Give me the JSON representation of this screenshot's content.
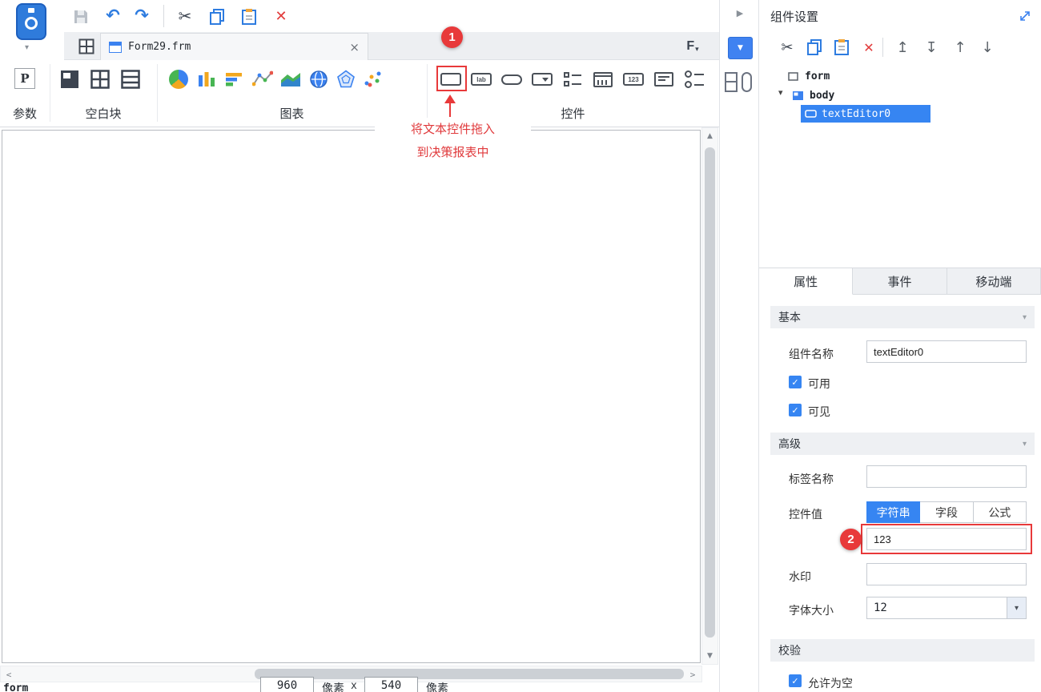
{
  "icons": {
    "undo": "↶",
    "redo": "↷",
    "scissors": "✂",
    "delete_x": "✕",
    "close": "×",
    "caret_down": "▾",
    "dropdown": "▼",
    "collapse": "▶",
    "scroll_up": "▲",
    "scroll_down": "▼",
    "scroll_left": "<",
    "scroll_right": ">",
    "move_top": "↥",
    "move_bottom": "↧",
    "move_up": "↑",
    "move_down": "↓",
    "check": "✓",
    "p_letter": "P",
    "lab": "lab",
    "num123": "123",
    "f_letter": "F"
  },
  "tabbar": {
    "active_tab": "Form29.frm"
  },
  "ribbon": {
    "groups": {
      "params": "参数",
      "blocks": "空白块",
      "charts": "图表",
      "widgets": "控件"
    }
  },
  "annotations": {
    "step1": "1",
    "step1_text1": "将文本控件拖入",
    "step1_text2": "到决策报表中",
    "step2": "2"
  },
  "statusbar": {
    "form_label": "form",
    "width": "960",
    "unit": "像素",
    "times": "x",
    "height": "540"
  },
  "right_panel": {
    "title": "组件设置",
    "tree": {
      "form": "form",
      "body": "body",
      "selected": "textEditor0"
    },
    "tabs": [
      "属性",
      "事件",
      "移动端"
    ],
    "basic": {
      "header": "基本",
      "name_label": "组件名称",
      "name_value": "textEditor0",
      "enabled_label": "可用",
      "visible_label": "可见"
    },
    "advanced": {
      "header": "高级",
      "tag_label": "标签名称",
      "tag_value": "",
      "value_label": "控件值",
      "modes": [
        "字符串",
        "字段",
        "公式"
      ],
      "value_text": "123",
      "watermark_label": "水印",
      "watermark_value": "",
      "fontsize_label": "字体大小",
      "fontsize_value": "12"
    },
    "validation": {
      "header": "校验",
      "allow_empty_label": "允许为空"
    }
  }
}
